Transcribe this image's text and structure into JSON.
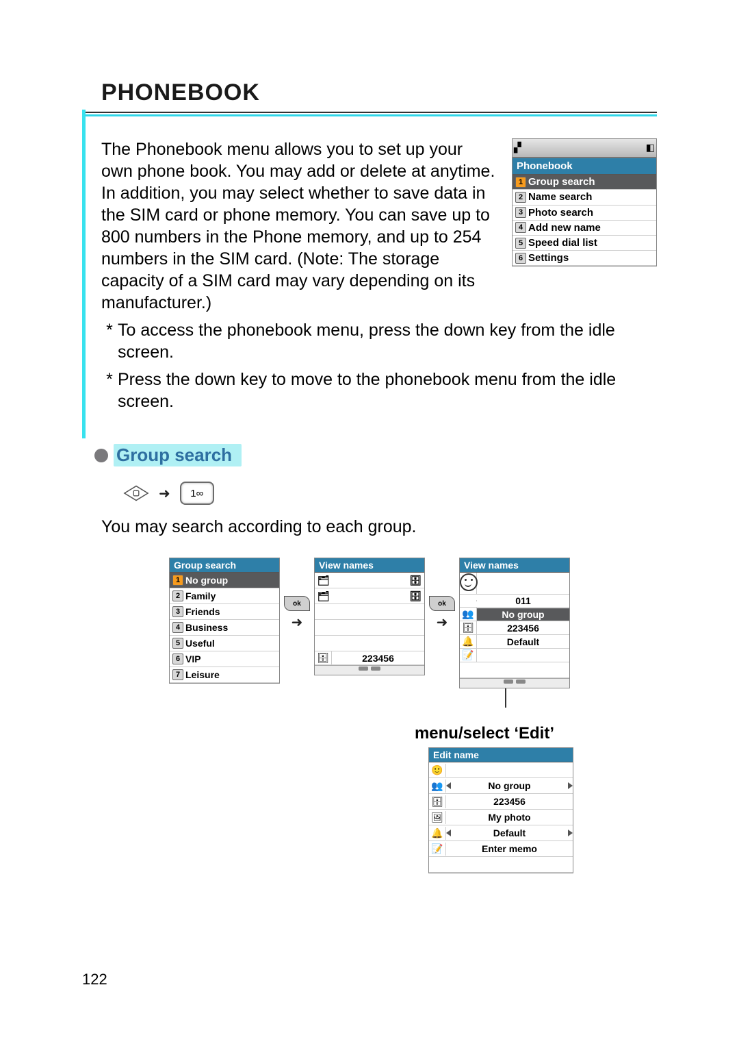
{
  "page": {
    "title": "PHONEBOOK",
    "number": "122"
  },
  "intro": "The Phonebook menu allows you to set up your own phone book. You may add or delete at anytime. In addition, you may select whether to save data in the SIM card or phone memory. You can save up to 800 numbers in the Phone memory, and up to 254 numbers in the SIM card. (Note: The storage capacity of a SIM card may vary depending on its manufacturer.)",
  "notes": [
    "To access the phonebook menu, press the down key from the idle screen.",
    "Press the down key to move to the phonebook menu from the idle screen."
  ],
  "section": {
    "title": "Group search",
    "key_hint": "1∞",
    "description": "You may search according to each group.",
    "action_label": "menu/select ‘Edit’"
  },
  "phonebook_menu": {
    "title": "Phonebook",
    "items": [
      {
        "n": "1",
        "label": "Group search",
        "sel": true
      },
      {
        "n": "2",
        "label": "Name search"
      },
      {
        "n": "3",
        "label": "Photo search"
      },
      {
        "n": "4",
        "label": "Add new name"
      },
      {
        "n": "5",
        "label": "Speed dial list"
      },
      {
        "n": "6",
        "label": "Settings"
      }
    ]
  },
  "group_search_screen": {
    "title": "Group search",
    "items": [
      {
        "n": "1",
        "label": "No group",
        "sel": true
      },
      {
        "n": "2",
        "label": "Family"
      },
      {
        "n": "3",
        "label": "Friends"
      },
      {
        "n": "4",
        "label": "Business"
      },
      {
        "n": "5",
        "label": "Useful"
      },
      {
        "n": "6",
        "label": "VIP"
      },
      {
        "n": "7",
        "label": "Leisure"
      }
    ]
  },
  "view_names_1": {
    "title": "View names",
    "footer_icon": "sim",
    "footer_value": "223456"
  },
  "view_names_2": {
    "title": "View names",
    "rows": [
      {
        "icon": "smiley",
        "value": ""
      },
      {
        "icon": "",
        "value": "011"
      },
      {
        "icon": "group",
        "value": "No group",
        "sel": true
      },
      {
        "icon": "sim",
        "value": "223456"
      },
      {
        "icon": "bell",
        "value": "Default"
      },
      {
        "icon": "memo",
        "value": ""
      }
    ]
  },
  "edit_name": {
    "title": "Edit name",
    "rows": [
      {
        "icon": "face",
        "value": ""
      },
      {
        "icon": "group",
        "value": "No group",
        "arrows": true
      },
      {
        "icon": "sim",
        "value": "223456"
      },
      {
        "icon": "photo",
        "value": "My photo"
      },
      {
        "icon": "bell",
        "value": "Default",
        "arrows": true
      },
      {
        "icon": "memo",
        "value": "Enter memo"
      }
    ]
  },
  "ok_label": "ok"
}
